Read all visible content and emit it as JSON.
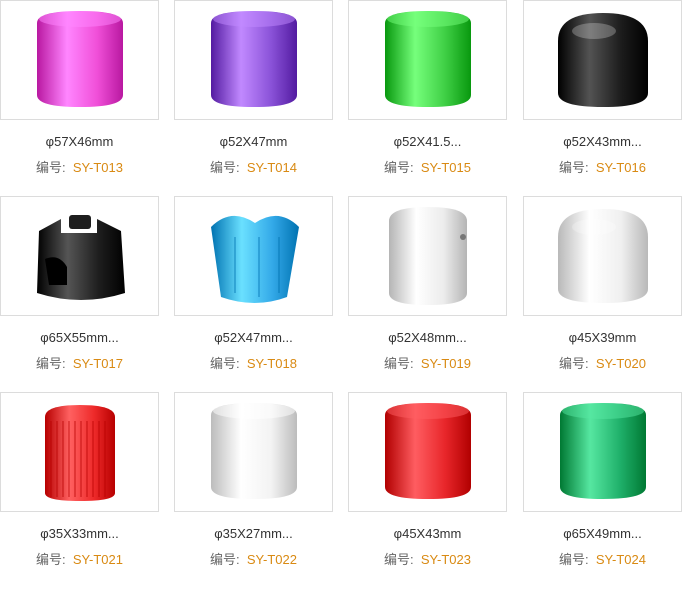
{
  "code_label": "编号:",
  "products": [
    {
      "title": "φ57X46mm",
      "code": "SY-T013",
      "color": "#f04fd8",
      "shape": "round-tall"
    },
    {
      "title": "φ52X47mm",
      "code": "SY-T014",
      "color": "#8a52d8",
      "shape": "round-tall"
    },
    {
      "title": "φ52X41.5...",
      "code": "SY-T015",
      "color": "#3fcf45",
      "shape": "round-tall"
    },
    {
      "title": "φ52X43mm...",
      "code": "SY-T016",
      "color": "#1c1c1c",
      "shape": "dome"
    },
    {
      "title": "φ65X55mm...",
      "code": "SY-T017",
      "color": "#1e1e1e",
      "shape": "trigger"
    },
    {
      "title": "φ52X47mm...",
      "code": "SY-T018",
      "color": "#33a9e8",
      "shape": "flare"
    },
    {
      "title": "φ52X48mm...",
      "code": "SY-T019",
      "color": "#ececec",
      "shape": "spray"
    },
    {
      "title": "φ45X39mm",
      "code": "SY-T020",
      "color": "#f0f0f0",
      "shape": "dome"
    },
    {
      "title": "φ35X33mm...",
      "code": "SY-T021",
      "color": "#ee2a2a",
      "shape": "ribbed"
    },
    {
      "title": "φ35X27mm...",
      "code": "SY-T022",
      "color": "#f3f3f3",
      "shape": "round-tall"
    },
    {
      "title": "φ45X43mm",
      "code": "SY-T023",
      "color": "#e8262a",
      "shape": "round-tall"
    },
    {
      "title": "φ65X49mm...",
      "code": "SY-T024",
      "color": "#1fb06a",
      "shape": "round-tall"
    }
  ]
}
